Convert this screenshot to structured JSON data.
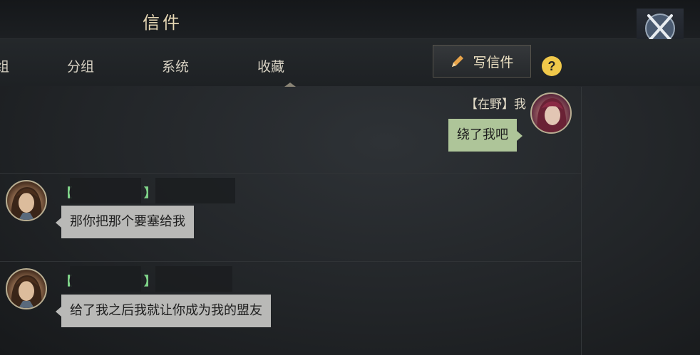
{
  "window": {
    "title": "信件",
    "close_icon": "crossed-swords-icon"
  },
  "tabs": {
    "edge_label": "组",
    "items": [
      {
        "label": "分组"
      },
      {
        "label": "系统"
      },
      {
        "label": "收藏",
        "active": true
      }
    ]
  },
  "toolbar": {
    "compose_label": "写信件",
    "compose_icon": "pencil-icon",
    "help_label": "?"
  },
  "messages": [
    {
      "side": "self",
      "sender_prefix": "【在野】",
      "sender_name": "我",
      "text": "绕了我吧",
      "avatar": "female-warrior-avatar"
    },
    {
      "side": "other",
      "bracket_open": "【",
      "bracket_close": "】",
      "text": "那你把那个要塞给我",
      "avatar": "male-warrior-avatar"
    },
    {
      "side": "other",
      "bracket_open": "【",
      "bracket_close": "】",
      "text": "给了我之后我就让你成为我的盟友",
      "avatar": "male-warrior-avatar"
    }
  ],
  "colors": {
    "accent_gold": "#e6d7b4",
    "bracket_green": "#7fd389",
    "self_bubble": "#aec599",
    "other_bubble": "#b9b9b7",
    "help_yellow": "#f0c84a"
  }
}
